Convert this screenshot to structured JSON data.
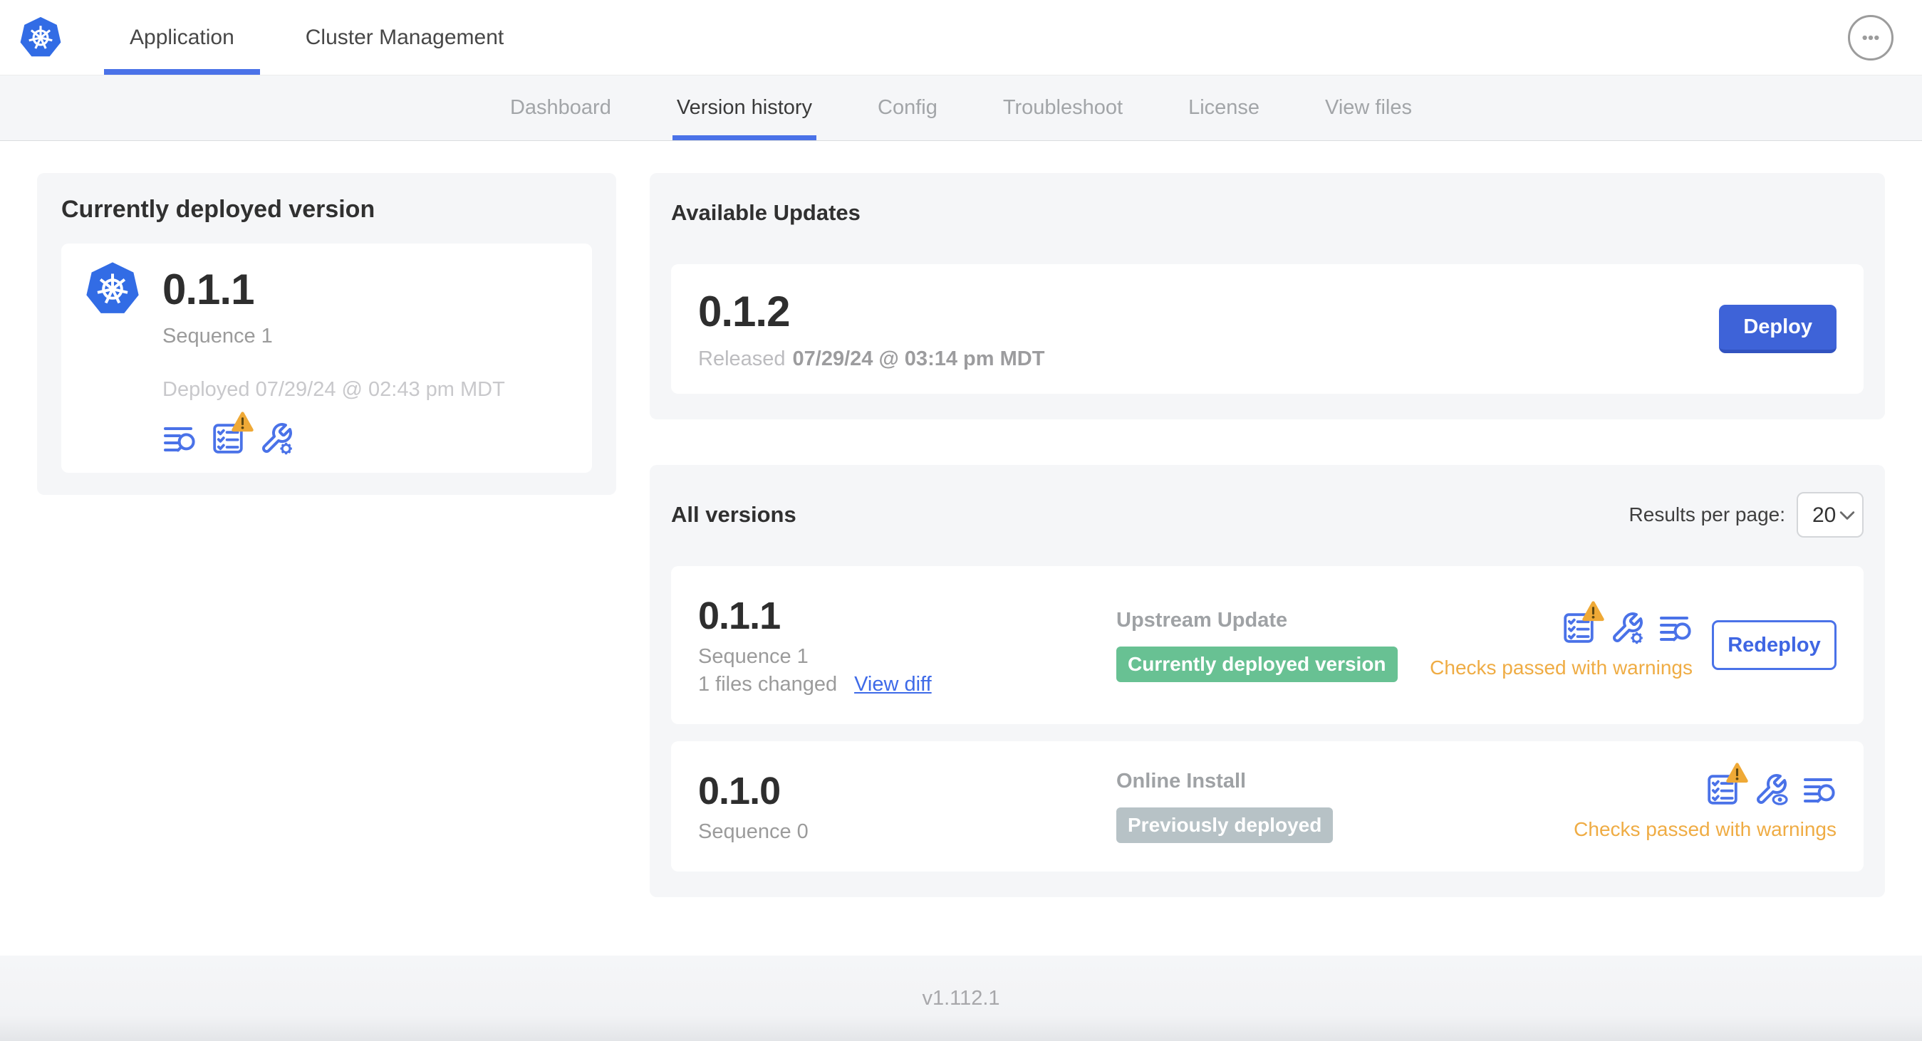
{
  "header": {
    "tabs": [
      {
        "label": "Application"
      },
      {
        "label": "Cluster Management"
      }
    ],
    "active_tab": "Application",
    "icons": [
      "kubernetes-logo",
      "ellipsis-menu-icon"
    ]
  },
  "subnav": {
    "tabs": [
      {
        "label": "Dashboard"
      },
      {
        "label": "Version history"
      },
      {
        "label": "Config"
      },
      {
        "label": "Troubleshoot"
      },
      {
        "label": "License"
      },
      {
        "label": "View files"
      }
    ],
    "active_tab": "Version history"
  },
  "current_version_card": {
    "title": "Currently deployed version",
    "version": "0.1.1",
    "sequence": "Sequence 1",
    "deployed": "Deployed 07/29/24 @ 02:43 pm MDT",
    "icons": [
      "release-notes-icon",
      "preflight-checks-warning-icon",
      "config-wrench-gear-icon"
    ]
  },
  "available_updates": {
    "title": "Available Updates",
    "version": "0.1.2",
    "released_label": "Released",
    "released_date": "07/29/24 @ 03:14 pm MDT",
    "deploy_button": "Deploy"
  },
  "all_versions": {
    "title": "All versions",
    "results_per_page_label": "Results per page:",
    "results_per_page_value": "20",
    "rows": [
      {
        "version": "0.1.1",
        "sequence": "Sequence 1",
        "files_changed": "1 files changed",
        "view_diff": "View diff",
        "source_type": "Upstream Update",
        "status_badge": "Currently deployed version",
        "badge_color": "#68C193",
        "checks_status": "Checks passed with warnings",
        "action_button": "Redeploy",
        "icons": [
          "preflight-checks-warning-icon",
          "config-wrench-gear-icon",
          "release-notes-icon"
        ]
      },
      {
        "version": "0.1.0",
        "sequence": "Sequence 0",
        "source_type": "Online Install",
        "status_badge": "Previously deployed",
        "badge_color": "#B7C2C6",
        "checks_status": "Checks passed with warnings",
        "icons": [
          "preflight-checks-warning-icon",
          "config-wrench-eye-icon",
          "release-notes-icon"
        ]
      }
    ]
  },
  "footer": {
    "app_version": "v1.112.1"
  },
  "colors": {
    "accent_blue": "#4A72E8",
    "deploy_button_blue": "#3E63D8",
    "link_blue": "#3E6AE8",
    "warning_amber": "#EFAC44",
    "warning_triangle": "#EFA936",
    "badge_green": "#68C193",
    "badge_gray": "#B7C2C6",
    "kubernetes_blue": "#326CE5",
    "section_background": "#F5F6F8"
  }
}
